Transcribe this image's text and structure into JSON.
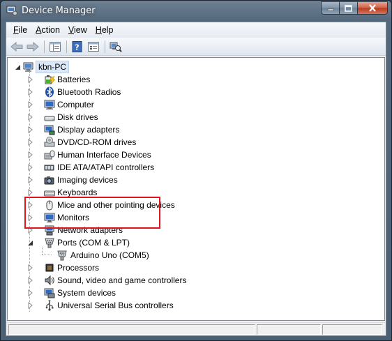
{
  "window": {
    "title": "Device Manager"
  },
  "menu": [
    {
      "label": "File",
      "mnemonic": "F",
      "rest": "ile"
    },
    {
      "label": "Action",
      "mnemonic": "A",
      "rest": "ction"
    },
    {
      "label": "View",
      "mnemonic": "V",
      "rest": "iew"
    },
    {
      "label": "Help",
      "mnemonic": "H",
      "rest": "elp"
    }
  ],
  "toolbar": [
    "back-arrow-icon",
    "forward-arrow-icon",
    "show-hide-console-tree-icon",
    "help-icon",
    "properties-icon",
    "scan-hardware-icon"
  ],
  "tree": {
    "root": "kbn-PC",
    "categories": [
      {
        "label": "Batteries",
        "icon": "battery-icon"
      },
      {
        "label": "Bluetooth Radios",
        "icon": "bluetooth-icon"
      },
      {
        "label": "Computer",
        "icon": "computer-icon"
      },
      {
        "label": "Disk drives",
        "icon": "disk-drive-icon"
      },
      {
        "label": "Display adapters",
        "icon": "display-adapter-icon"
      },
      {
        "label": "DVD/CD-ROM drives",
        "icon": "dvd-drive-icon"
      },
      {
        "label": "Human Interface Devices",
        "icon": "hid-icon"
      },
      {
        "label": "IDE ATA/ATAPI controllers",
        "icon": "ide-controller-icon"
      },
      {
        "label": "Imaging devices",
        "icon": "camera-icon"
      },
      {
        "label": "Keyboards",
        "icon": "keyboard-icon"
      },
      {
        "label": "Mice and other pointing devices",
        "icon": "mouse-icon"
      },
      {
        "label": "Monitors",
        "icon": "monitor-icon"
      },
      {
        "label": "Network adapters",
        "icon": "network-adapter-icon"
      },
      {
        "label": "Ports (COM & LPT)",
        "icon": "port-icon",
        "expanded": true,
        "children": [
          {
            "label": "Arduino Uno (COM5)",
            "icon": "port-icon"
          }
        ]
      },
      {
        "label": "Processors",
        "icon": "processor-icon"
      },
      {
        "label": "Sound, video and game controllers",
        "icon": "speaker-icon"
      },
      {
        "label": "System devices",
        "icon": "system-device-icon"
      },
      {
        "label": "Universal Serial Bus controllers",
        "icon": "usb-icon"
      }
    ]
  },
  "colors": {
    "highlight": "#e2141b",
    "titlebar": "#55697d"
  }
}
